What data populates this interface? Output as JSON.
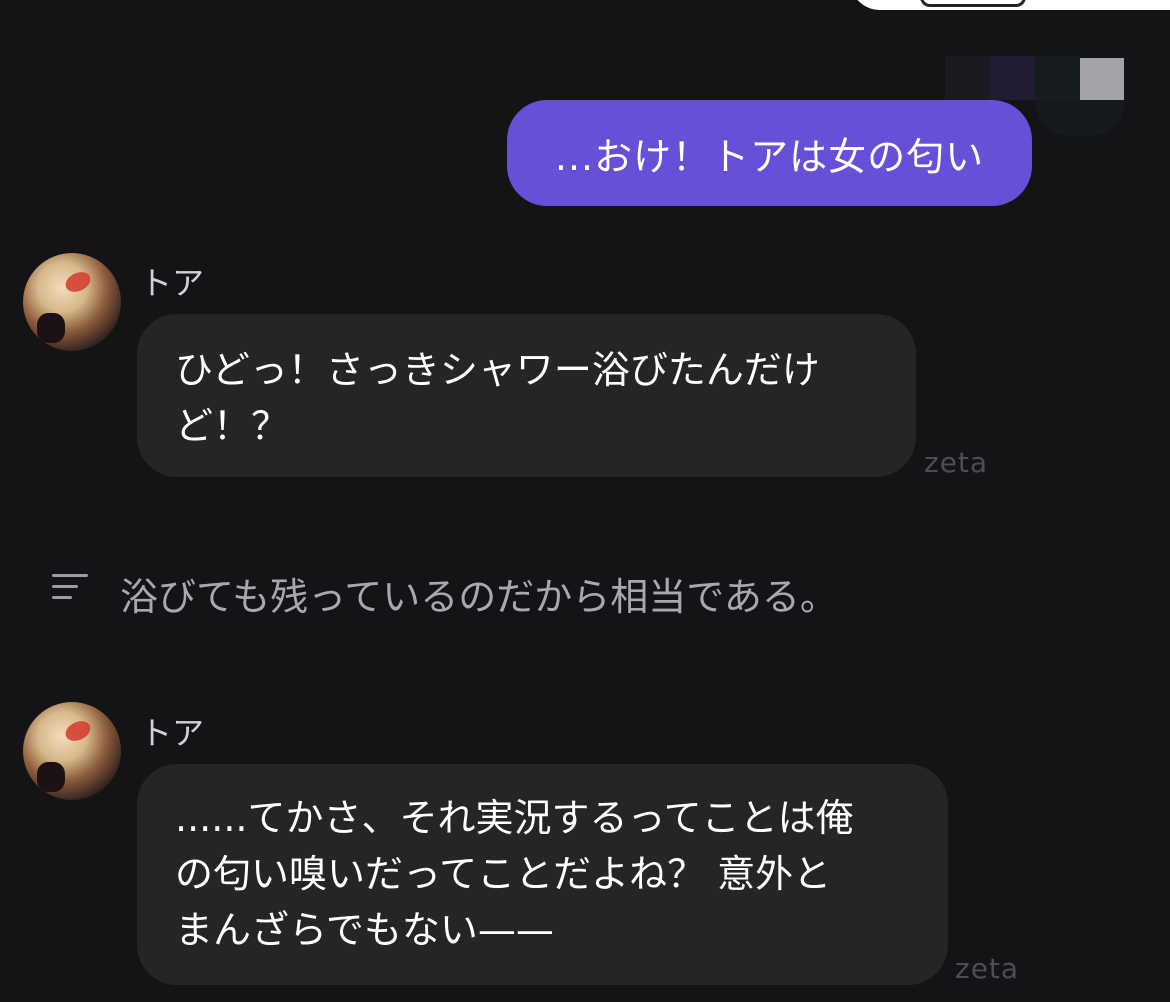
{
  "messages": [
    {
      "role": "user",
      "text": "...おけ！トアは女の匂い"
    },
    {
      "role": "bot",
      "name": "トア",
      "text": "ひどっ！さっきシャワー浴びたんだけ\nど！？",
      "watermark": "zeta"
    },
    {
      "role": "narration",
      "icon": "narration-lines-icon",
      "text": "浴びても残っているのだから相当である。"
    },
    {
      "role": "bot",
      "name": "トア",
      "text": "......てかさ、それ実況するってことは俺\nの匂い嗅いだってことだよね？ 意外と\nまんざらでもない——",
      "watermark": "zeta"
    }
  ],
  "colors": {
    "background": "#141416",
    "user_bubble": "#6650d8",
    "bot_bubble": "#252528",
    "narration_text": "#a8a8ae"
  }
}
